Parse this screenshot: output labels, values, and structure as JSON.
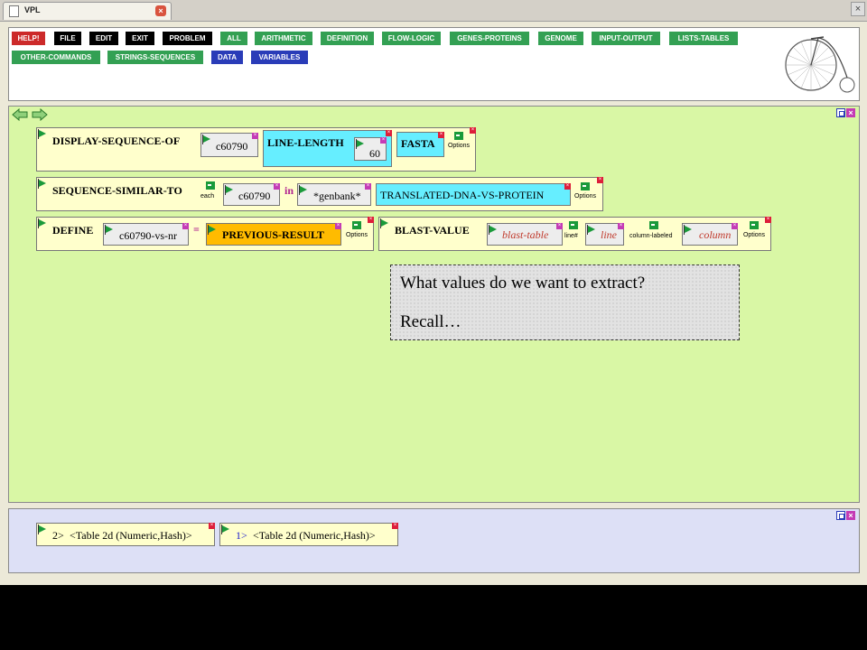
{
  "tab": {
    "title": "VPL"
  },
  "menu": {
    "row1": [
      "HELP!",
      "FILE",
      "EDIT",
      "EXIT",
      "PROBLEM",
      "ALL",
      "ARITHMETIC",
      "DEFINITION",
      "FLOW-LOGIC",
      "GENES-PROTEINS",
      "GENOME",
      "INPUT-OUTPUT",
      "LISTS-TABLES"
    ],
    "row2": [
      "OTHER-COMMANDS",
      "STRINGS-SEQUENCES",
      "DATA",
      "VARIABLES"
    ]
  },
  "blocks": {
    "display": {
      "keyword": "DISPLAY-SEQUENCE-OF",
      "arg": "c60790",
      "option_keyword": "LINE-LENGTH",
      "option_value": "60",
      "format": "FASTA"
    },
    "similar": {
      "keyword": "SEQUENCE-SIMILAR-TO",
      "each_label": "each",
      "arg": "c60790",
      "in_label": "in",
      "database": "*genbank*",
      "program": "TRANSLATED-DNA-VS-PROTEIN"
    },
    "define": {
      "keyword": "DEFINE",
      "variable": "c60790-vs-nr",
      "equals": "=",
      "value": "PREVIOUS-RESULT"
    },
    "blast": {
      "keyword": "BLAST-VALUE",
      "arg1": "blast-table",
      "label1": "line#",
      "arg2": "line",
      "label2": "column-labeled",
      "arg3": "column"
    },
    "options_label": "Options"
  },
  "note": {
    "line1": "What values do we want to extract?",
    "line2": "Recall…"
  },
  "results": [
    {
      "num": "2>",
      "text": "<Table 2d (Numeric,Hash)>"
    },
    {
      "num": "1>",
      "text": "<Table 2d (Numeric,Hash)>"
    }
  ]
}
